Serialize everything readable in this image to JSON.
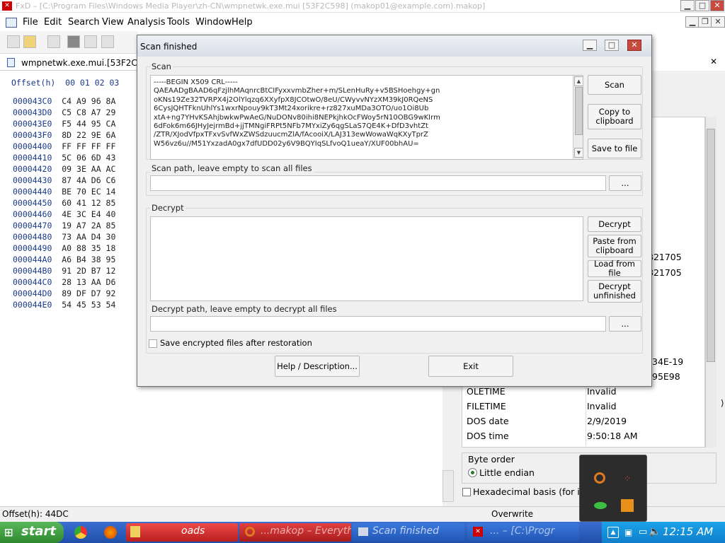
{
  "app": {
    "title": "FxD – [C:\\Program Files\\Windows Media Player\\zh-CN\\wmpnetwk.exe.mui [53F2C598] (makop01@example.com).makop]",
    "window_icon": "app-icon"
  },
  "menu": [
    "File",
    "Edit",
    "Search",
    "View",
    "Analysis",
    "Tools",
    "Window",
    "Help"
  ],
  "doc_tab": "wmpnetwk.exe.mui.[53F2C598",
  "hex": {
    "header": "Offset(h)  00 01 02 03",
    "rows": [
      {
        "offset": "000043C0",
        "bytes": "C4 A9 96 8A"
      },
      {
        "offset": "000043D0",
        "bytes": "C5 C8 A7 29"
      },
      {
        "offset": "000043E0",
        "bytes": "F5 44 95 CA"
      },
      {
        "offset": "000043F0",
        "bytes": "8D 22 9E 6A"
      },
      {
        "offset": "00004400",
        "bytes": "FF FF FF FF"
      },
      {
        "offset": "00004410",
        "bytes": "5C 06 6D 43"
      },
      {
        "offset": "00004420",
        "bytes": "09 3E AA AC"
      },
      {
        "offset": "00004430",
        "bytes": "87 4A D6 C6"
      },
      {
        "offset": "00004440",
        "bytes": "BE 70 EC 14"
      },
      {
        "offset": "00004450",
        "bytes": "60 41 12 85"
      },
      {
        "offset": "00004460",
        "bytes": "4E 3C E4 40"
      },
      {
        "offset": "00004470",
        "bytes": "19 A7 2A 85"
      },
      {
        "offset": "00004480",
        "bytes": "73 AA D4 30"
      },
      {
        "offset": "00004490",
        "bytes": "A0 88 35 18"
      },
      {
        "offset": "000044A0",
        "bytes": "A6 B4 38 95"
      },
      {
        "offset": "000044B0",
        "bytes": "91 2D B7 12"
      },
      {
        "offset": "000044C0",
        "bytes": "28 13 AA D6"
      },
      {
        "offset": "000044D0",
        "bytes": "89 DF D7 92"
      },
      {
        "offset": "000044E0",
        "bytes": "54 45 53 54"
      }
    ]
  },
  "status": {
    "offset": "Offset(h): 44DC",
    "mode": "Overwrite"
  },
  "inspector": {
    "partial_values": [
      {
        "label": "",
        "value": "821705"
      },
      {
        "label": "",
        "value": "821705"
      },
      {
        "label": "",
        "value": "34E-19"
      },
      {
        "label": "",
        "value": "95E98"
      }
    ],
    "rows": [
      {
        "label": "OLETIME",
        "value": "Invalid"
      },
      {
        "label": "FILETIME",
        "value": "Invalid"
      },
      {
        "label": "DOS date",
        "value": "2/9/2019"
      },
      {
        "label": "DOS time",
        "value": "9:50:18 AM"
      }
    ],
    "byte_order_label": "Byte order",
    "little_endian": "Little endian",
    "hex_basis": "Hexadecimal basis (for inte"
  },
  "dialog": {
    "title": "Scan finished",
    "scan_label": "Scan",
    "scan_text": "-----BEGIN X509 CRL-----\nQAEAADgBAAD6qFzjlhMAqnrcBtCIFyxxvmbZher+m/SLenHuRy+v5BSHoehgy+gn\noKNs19Ze32TVRPX4j2OlYlqzq6XXyfpX8JCOtwO/8eU/CWyvvNYzXM39kJ0RQeNS\n6CysJQHTFknUhlYs1wxrNpouy9kT3Mt24xorikre+rz827xuMDa3OTO/uo1Oi8Ub\nxtA+ng7YHvKSAhjbwkwPwAeG/NuDONv80ihi8NEPkjhkOcFWoy5rN10OBG9wKIrm\n6dFok6m66JHyJejrmBd+jjTMNgiFRPt5NFb7MYxiZy6qgSLaS7QE4K+DfD3vhtZt\n/ZTR/XJodVfpxTFxvSvfWxZWSdzuucmZlA/fAcooiX/LAJ313ewWowaWqKXyTprZ\nW56vz6u//M51YxzadA0gx7dfUDD02y6V9BQYIqSLfvoQ1ueaY/XUF00bhAU=",
    "buttons": {
      "scan": "Scan",
      "copy": "Copy to\nclipboard",
      "save": "Save to file",
      "decrypt": "Decrypt",
      "paste": "Paste from\nclipboard",
      "load": "Load from file",
      "decrypt_unfinished": "Decrypt\nunfinished",
      "browse": "...",
      "help": "Help / Description...",
      "exit": "Exit"
    },
    "scan_path_label": "Scan path, leave empty to scan all files",
    "scan_path_value": "",
    "decrypt_label": "Decrypt",
    "decrypt_text": "",
    "decrypt_path_label": "Decrypt path, leave empty to decrypt all files",
    "decrypt_path_value": "",
    "save_encrypted_label": "Save encrypted files after restoration",
    "save_encrypted_checked": false
  },
  "taskbar": {
    "start": "start",
    "items": [
      {
        "label": "oads",
        "color": "#e23a3a"
      },
      {
        "label": "...makop – Everyth",
        "color": "#c33"
      },
      {
        "label": "Scan finished",
        "color": "#3a6ed0"
      },
      {
        "label": "... – [C:\\Progr",
        "color": "#3a6ed0"
      }
    ],
    "time": "12:15 AM"
  }
}
